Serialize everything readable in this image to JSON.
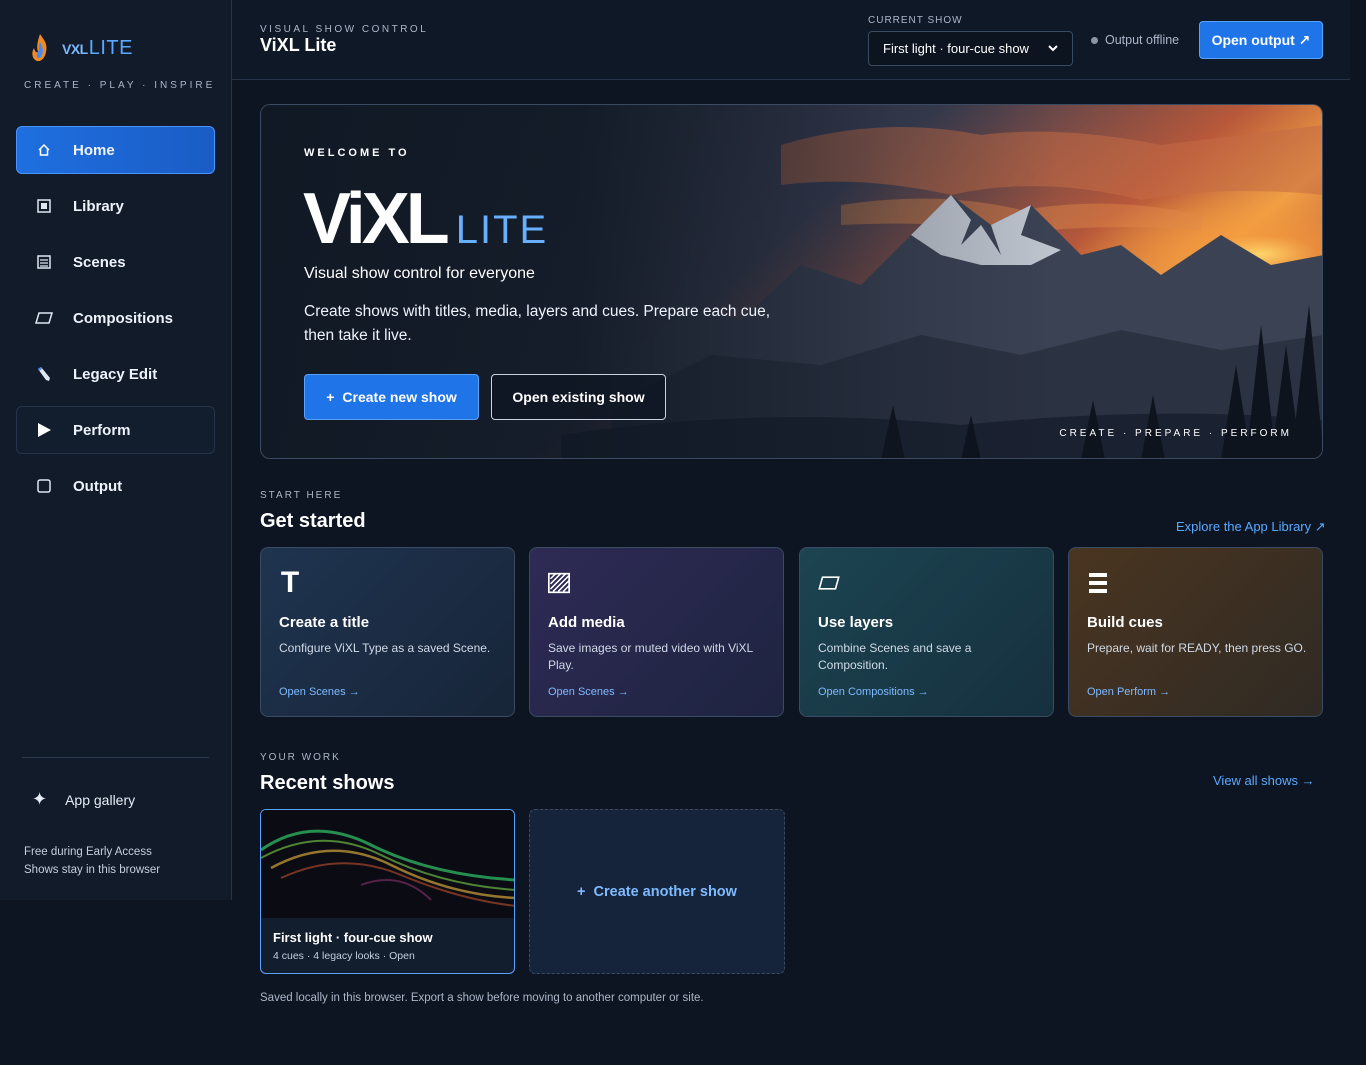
{
  "sidebar": {
    "brand_prefix": "VXL",
    "brand_suffix": "LITE",
    "tagline": "CREATE · PLAY · INSPIRE",
    "items": [
      {
        "label": "Home",
        "icon": "home-icon"
      },
      {
        "label": "Library",
        "icon": "library-icon"
      },
      {
        "label": "Scenes",
        "icon": "scenes-icon"
      },
      {
        "label": "Compositions",
        "icon": "compositions-icon"
      },
      {
        "label": "Legacy Edit",
        "icon": "pencil-icon"
      },
      {
        "label": "Perform",
        "icon": "play-icon"
      },
      {
        "label": "Output",
        "icon": "output-icon"
      }
    ],
    "gallery_label": "App gallery",
    "footer_line1": "Free during Early Access",
    "footer_line2": "Shows stay in this browser"
  },
  "header": {
    "kicker": "VISUAL SHOW CONTROL",
    "title": "ViXL Lite",
    "current_show_label": "CURRENT SHOW",
    "current_show_value": "First light · four-cue show",
    "status": "Output offline",
    "open_output_label": "Open output ↗"
  },
  "hero": {
    "welcome": "WELCOME TO",
    "logo_main": "ViXL",
    "logo_lite": "LITE",
    "subtitle": "Visual show control for everyone",
    "description": "Create shows with titles, media, layers and cues. Prepare each cue, then take it live.",
    "create_label": "Create new show",
    "open_label": "Open existing show",
    "tagline": "CREATE · PREPARE · PERFORM"
  },
  "get_started": {
    "kicker": "START HERE",
    "title": "Get started",
    "link": "Explore the App Library ↗",
    "cards": [
      {
        "title": "Create a title",
        "desc": "Configure ViXL Type as a saved Scene.",
        "link": "Open Scenes →",
        "icon": "text-icon"
      },
      {
        "title": "Add media",
        "desc": "Save images or muted video with ViXL Play.",
        "link": "Open Scenes →",
        "icon": "media-icon"
      },
      {
        "title": "Use layers",
        "desc": "Combine Scenes and save a Composition.",
        "link": "Open Compositions →",
        "icon": "layers-icon"
      },
      {
        "title": "Build cues",
        "desc": "Prepare, wait for READY, then press GO.",
        "link": "Open Perform →",
        "icon": "cues-icon"
      }
    ]
  },
  "recent": {
    "kicker": "YOUR WORK",
    "title": "Recent shows",
    "link": "View all shows →",
    "show_title": "First light · four-cue show",
    "show_meta": "4 cues · 4 legacy looks · Open",
    "create_another": "Create another show",
    "footnote": "Saved locally in this browser. Export a show before moving to another computer or site."
  },
  "colors": {
    "accent": "#1f74e8",
    "link": "#5aa9ff",
    "background": "#0d1522"
  }
}
